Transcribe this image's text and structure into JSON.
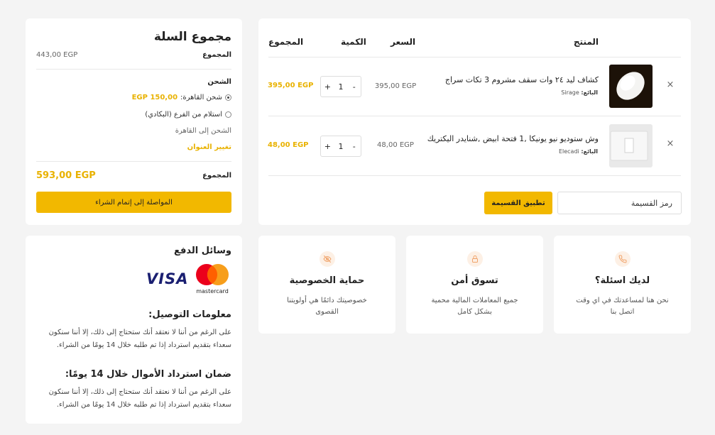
{
  "cart": {
    "headers": {
      "product": "المنتج",
      "price": "السعر",
      "quantity": "الكمية",
      "total": "المجموع"
    },
    "items": [
      {
        "name": "كشاف ليد ٢٤ وات سقف مشروم 3 تكات سراج",
        "vendor_label": "البائع:",
        "vendor": "Sirage",
        "price": "395,00 EGP",
        "quantity": "1",
        "subtotal": "395,00 EGP",
        "remove": "×"
      },
      {
        "name": "وش ستوديو نيو يونيكا ,1 فتحة ابيض ,شنايدر اليكتريك",
        "vendor_label": "البائع:",
        "vendor": "Elecadi",
        "price": "48,00 EGP",
        "quantity": "1",
        "subtotal": "48,00 EGP",
        "remove": "×"
      }
    ],
    "stepper": {
      "minus": "-",
      "plus": "+"
    },
    "coupon": {
      "placeholder": "رمز القسيمة",
      "button": "تطبيق القسيمة"
    }
  },
  "totals": {
    "title": "مجموع السلة",
    "subtotal_label": "المجموع",
    "subtotal_value": "443,00 EGP",
    "shipping_label": "الشحن",
    "shipping_options": [
      {
        "label": "شحن القاهرة:",
        "price": "150,00 EGP",
        "selected": true
      },
      {
        "label": "استلام من الفرع (البكادي)",
        "price": "",
        "selected": false
      }
    ],
    "shipping_to": "الشحن إلى القاهرة",
    "change_address": "تغيير العنوان",
    "total_label": "المجموع",
    "total_value": "593,00 EGP",
    "checkout_button": "المواصلة إلى إتمام الشراء"
  },
  "payment": {
    "title": "وسائل الدفع",
    "visa": "VISA",
    "mastercard": "mastercard",
    "delivery_title": "معلومات التوصيل:",
    "delivery_text": "على الرغم من أننا لا نعتقد أنك ستحتاج إلى ذلك، إلا أننا سنكون سعداء بتقديم استرداد إذا تم طلبه خلال 14 يومًا من الشراء.",
    "refund_title": "ضمان استرداد الأموال خلال 14 يومًا:",
    "refund_text": "على الرغم من أننا لا نعتقد أنك ستحتاج إلى ذلك، إلا أننا سنكون سعداء بتقديم استرداد إذا تم طلبه خلال 14 يومًا من الشراء."
  },
  "features": [
    {
      "icon": "phone-icon",
      "title": "لديك اسئلة؟",
      "desc": "نحن هنا لمساعدتك في اي وقت اتصل بنا"
    },
    {
      "icon": "lock-icon",
      "title": "تسوق أمن",
      "desc": "جميع المعاملات المالية محمية بشكل كامل"
    },
    {
      "icon": "eye-off-icon",
      "title": "حماية الخصوصية",
      "desc": "خصوصيتك دائمًا هي أولويتنا القصوى"
    }
  ],
  "colors": {
    "accent": "#f2b800",
    "accent_text": "#e9b200",
    "icon_tint": "#f0a36a",
    "background": "#f4f4f4"
  }
}
